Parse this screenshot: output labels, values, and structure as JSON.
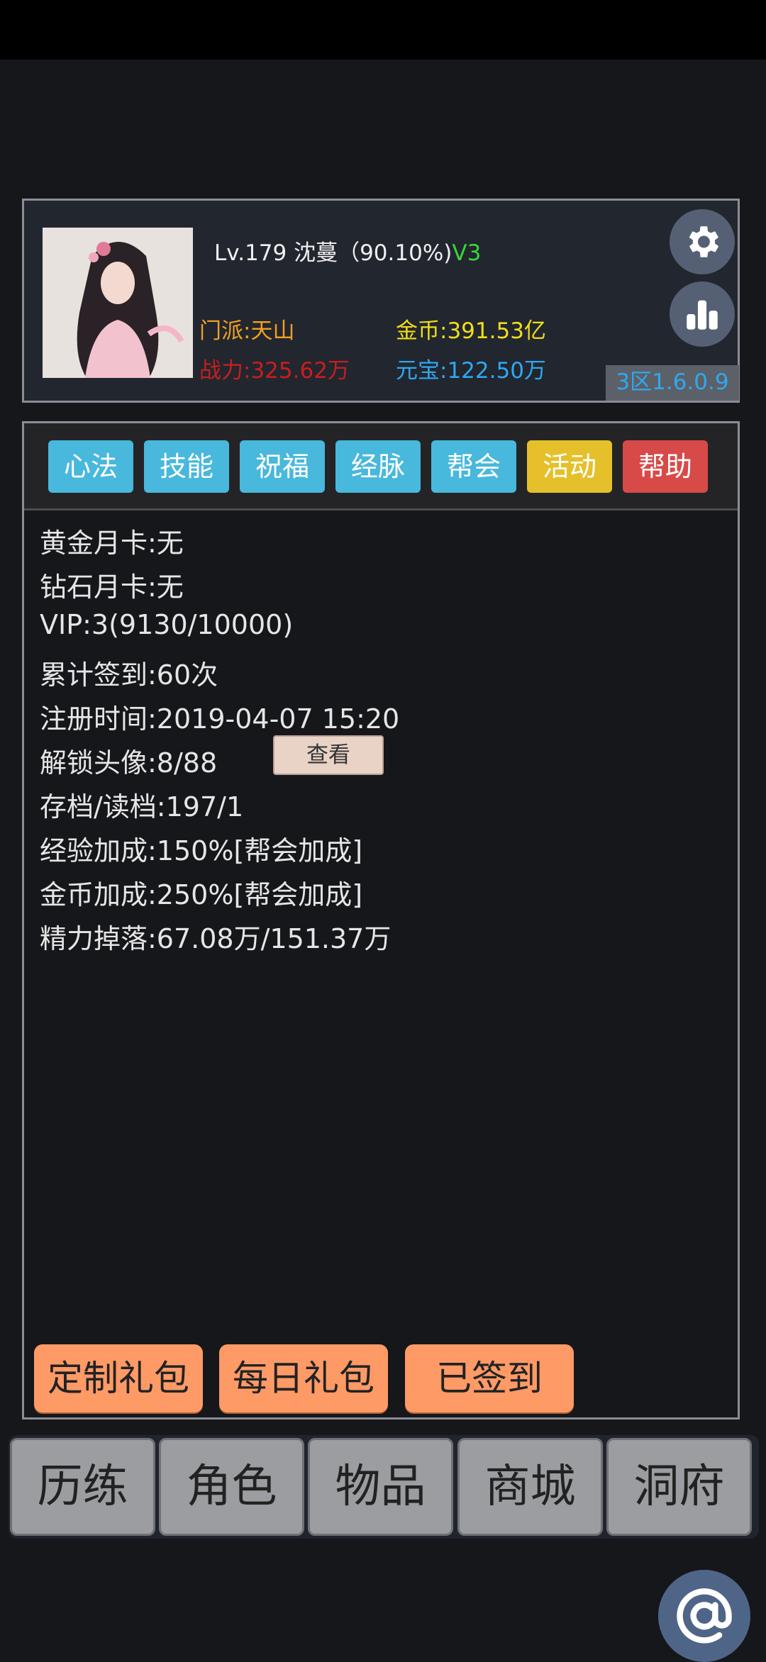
{
  "profile": {
    "level_name": "Lv.179 沈蔓（90.10%)",
    "vip_badge": "V3",
    "sect": "门派:天山",
    "power": "战力:325.62万",
    "gold": "金币:391.53亿",
    "ingot": "元宝:122.50万",
    "server_version": "3区1.6.0.9"
  },
  "tabs": [
    {
      "label": "心法",
      "color": "#48b8dc"
    },
    {
      "label": "技能",
      "color": "#48b8dc"
    },
    {
      "label": "祝福",
      "color": "#48b8dc"
    },
    {
      "label": "经脉",
      "color": "#48b8dc"
    },
    {
      "label": "帮会",
      "color": "#48b8dc"
    },
    {
      "label": "活动",
      "color": "#e5c02a"
    },
    {
      "label": "帮助",
      "color": "#d84a48"
    }
  ],
  "info": [
    "黄金月卡:无",
    "钻石月卡:无",
    "VIP:3(9130/10000)",
    "累计签到:60次",
    "注册时间:2019-04-07 15:20",
    "解锁头像:8/88",
    "存档/读档:197/1",
    "经验加成:150%[帮会加成]",
    "金币加成:250%[帮会加成]",
    "精力掉落:67.08万/151.37万"
  ],
  "view_button": "查看",
  "bottom_buttons": [
    "定制礼包",
    "每日礼包",
    "已签到"
  ],
  "nav": [
    "历练",
    "角色",
    "物品",
    "商城",
    "洞府"
  ],
  "icons": {
    "settings": "gear-icon",
    "ranking": "bar-chart-icon",
    "at": "at-sign-icon"
  }
}
